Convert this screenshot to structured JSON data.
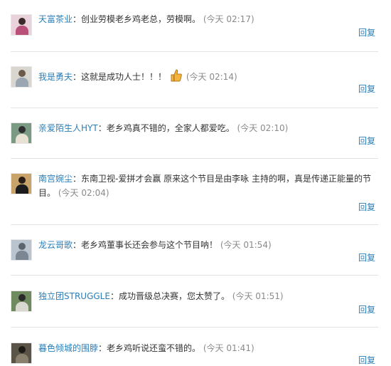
{
  "reply_label": "回复",
  "colors": {
    "link": "#2a7eb8",
    "time": "#8a8a8a",
    "divider": "#e3e3e3"
  },
  "comments": [
    {
      "user": "天富茶业",
      "sep": "：",
      "text": "创业劳模老乡鸡老总，劳模啊。",
      "time": "(今天 02:17)"
    },
    {
      "user": "我是勇夫",
      "sep": "：",
      "text": "这就是成功人士！！！",
      "time": "(今天 02:14)",
      "icon": "thumbs-up-icon"
    },
    {
      "user": "亲爱陌生人HYT",
      "sep": "：",
      "text": "老乡鸡真不错的，全家人都爱吃。",
      "time": "(今天 02:10)"
    },
    {
      "user": "南宫婉尘",
      "sep": "：",
      "text": "东南卫视-爱拼才会赢 原来这个节目是由李咏 主持的啊，真是传递正能量的节目。",
      "time": "(今天 02:04)"
    },
    {
      "user": "龙云哥歌",
      "sep": "：",
      "text": "老乡鸡董事长还会参与这个节目呐！",
      "time": "(今天 01:54)"
    },
    {
      "user": "独立团STRUGGLE",
      "sep": "：",
      "text": "成功晋级总决赛，您太赞了。",
      "time": "(今天 01:51)"
    },
    {
      "user": "暮色倾城的围脖",
      "sep": "：",
      "text": "老乡鸡听说还蛮不错的。",
      "time": "(今天 01:41)"
    }
  ]
}
